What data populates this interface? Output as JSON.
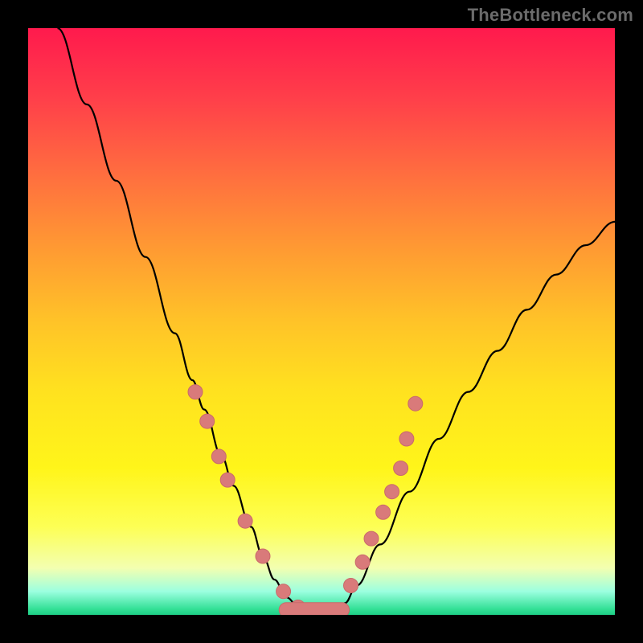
{
  "watermark": "TheBottleneck.com",
  "colors": {
    "curve": "#000000",
    "marker_fill": "#d97a7a",
    "marker_stroke": "#c96a6a",
    "gradient_top": "#ff1a4d",
    "gradient_bottom": "#1ecf86",
    "background": "#000000"
  },
  "chart_data": {
    "type": "line",
    "title": "",
    "xlabel": "",
    "ylabel": "",
    "xlim": [
      0,
      100
    ],
    "ylim": [
      0,
      100
    ],
    "grid": false,
    "legend_position": "none",
    "note": "Axes carry no labels or tick marks; x is relative position (0–100 left→right), y is bottleneck percentage (0 bottom → 100 top). Values estimated from pixel positions.",
    "series": [
      {
        "name": "bottleneck-curve",
        "x": [
          5,
          10,
          15,
          20,
          25,
          28,
          30,
          33,
          35,
          38,
          40,
          42,
          44,
          46,
          48,
          50,
          52,
          54,
          56,
          60,
          65,
          70,
          75,
          80,
          85,
          90,
          95,
          100
        ],
        "values": [
          100,
          87,
          74,
          61,
          48,
          40,
          35,
          27,
          22,
          15,
          10,
          6,
          3,
          1.5,
          0.8,
          0.5,
          0.8,
          2,
          5,
          12,
          21,
          30,
          38,
          45,
          52,
          58,
          63,
          67
        ]
      },
      {
        "name": "markers-left",
        "x": [
          28.5,
          30.5,
          32.5,
          34.0,
          37.0,
          40.0,
          43.5,
          46.0
        ],
        "values": [
          38.0,
          33.0,
          27.0,
          23.0,
          16.0,
          10.0,
          4.0,
          1.3
        ]
      },
      {
        "name": "markers-bottom",
        "x": [
          44.0,
          46.0,
          48.0,
          50.0,
          52.0,
          53.5
        ],
        "values": [
          0.7,
          0.6,
          0.6,
          0.6,
          0.9,
          1.8
        ]
      },
      {
        "name": "markers-right",
        "x": [
          55.0,
          57.0,
          58.5,
          60.5,
          62.0,
          63.5,
          64.5,
          66.0
        ],
        "values": [
          5.0,
          9.0,
          13.0,
          17.5,
          21.0,
          25.0,
          30.0,
          36.0
        ]
      }
    ]
  }
}
